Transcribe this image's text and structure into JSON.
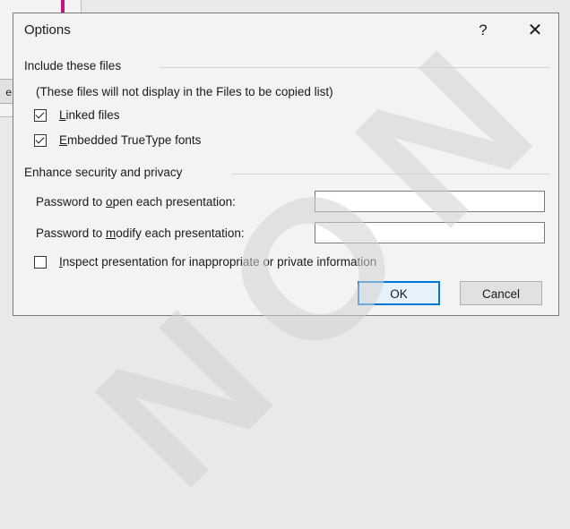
{
  "background": {
    "button_fragment_label": "e",
    "accent_color": "#c3157f"
  },
  "dialog": {
    "title": "Options",
    "help_label": "?",
    "close_label": "✕",
    "include_group": {
      "header": "Include these files",
      "note": "(These files will not display in the Files to be copied list)",
      "linked_files": {
        "underline": "L",
        "rest": "inked files",
        "checked": true
      },
      "embedded_fonts": {
        "underline": "E",
        "rest": "mbedded TrueType fonts",
        "checked": true
      }
    },
    "security_group": {
      "header": "Enhance security and privacy",
      "open_password": {
        "pre": "Password to ",
        "underline": "o",
        "post": "pen each presentation:",
        "value": ""
      },
      "modify_password": {
        "pre": "Password to ",
        "underline": "m",
        "post": "odify each presentation:",
        "value": ""
      },
      "inspect": {
        "underline": "I",
        "rest": "nspect presentation for inappropriate or private information",
        "checked": false
      }
    },
    "buttons": {
      "ok": "OK",
      "cancel": "Cancel"
    }
  },
  "watermark": "NON",
  "colors": {
    "ok_border": "#0078d7",
    "dialog_bg": "#f3f3f3",
    "watermark": "#d2d2d2"
  }
}
